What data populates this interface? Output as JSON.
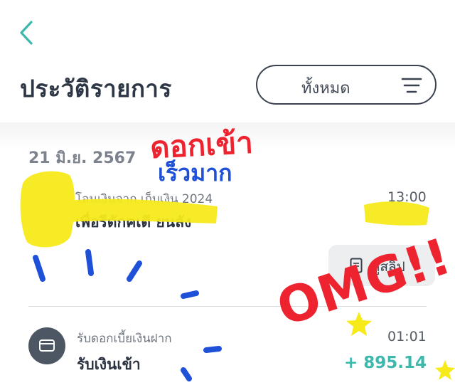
{
  "header": {
    "back_icon": "chevron-left-icon",
    "title": "ประวัติรายการ",
    "filter_label": "ทั้งหมด",
    "filter_icon": "menu-lines-icon"
  },
  "list": {
    "date": "21 มิ.ย. 2567",
    "transactions": [
      {
        "subtitle": "โอนเงินจาก เก็บเงิน 2024",
        "title": "เพื่อรีดักคเดี ยนลัง",
        "time": "13:00",
        "slip_label": "ดูสลิป",
        "slip_icon": "document-icon"
      },
      {
        "icon": "card-icon",
        "subtitle": "รับดอกเบี้ยเงินฝาก",
        "title": "รับเงินเข้า",
        "time": "01:01",
        "amount": "+ 895.14"
      }
    ]
  },
  "annotations": {
    "red_text_1": "ดอกเข้า",
    "blue_text": "เร็วมาก",
    "red_text_2": "OMG!!"
  },
  "colors": {
    "accent_teal": "#3cb8ad",
    "annotation_red": "#ee2330",
    "annotation_blue": "#1f50d8",
    "highlight_yellow": "#f6ea1a"
  }
}
